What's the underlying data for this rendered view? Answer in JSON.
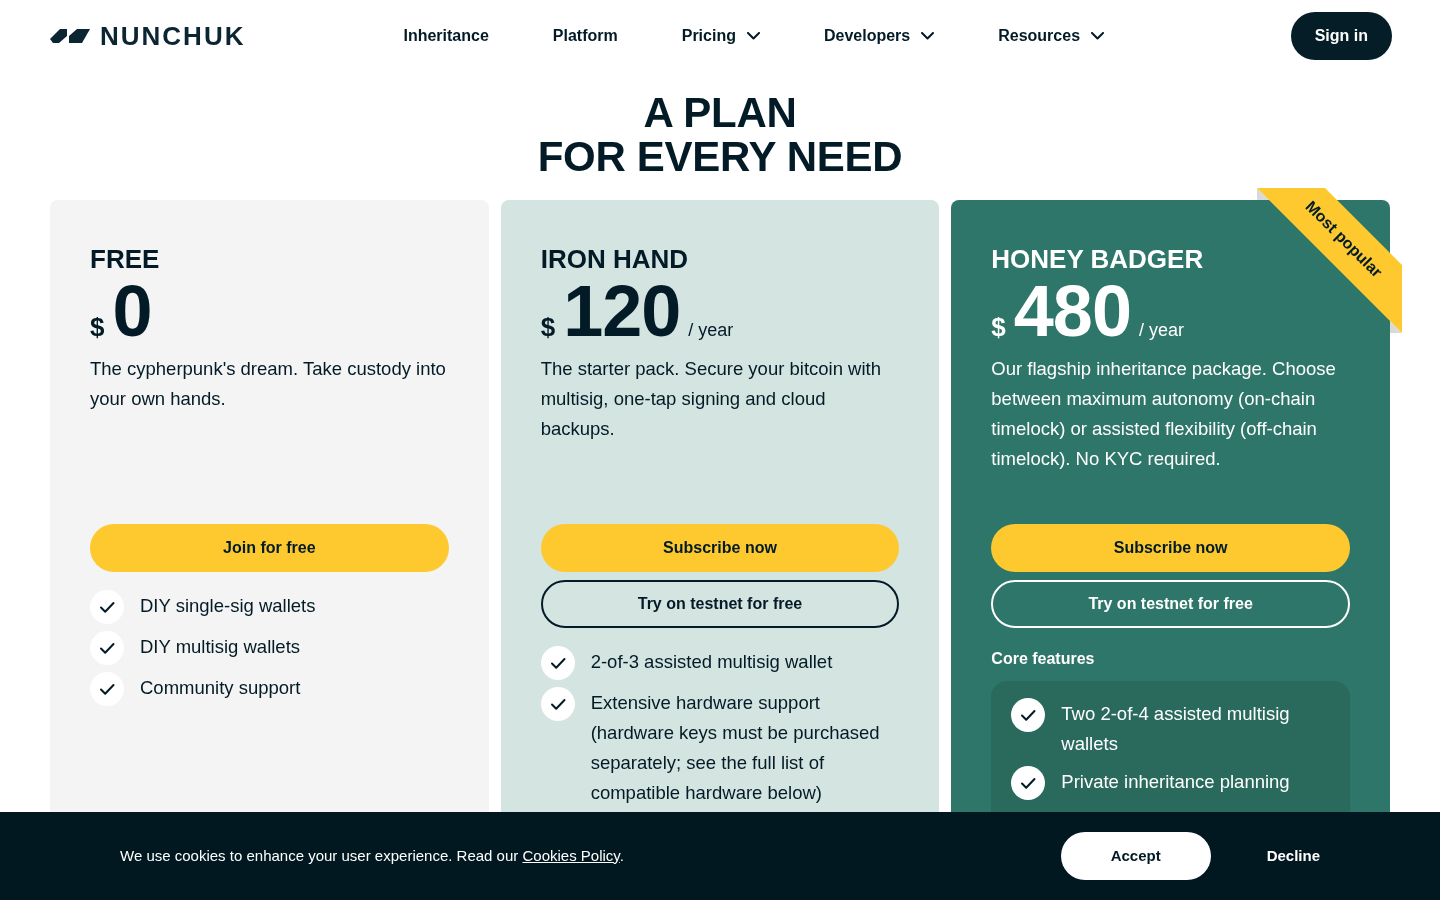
{
  "header": {
    "logo": "NUNCHUK",
    "nav": [
      {
        "label": "Inheritance",
        "dropdown": false
      },
      {
        "label": "Platform",
        "dropdown": false
      },
      {
        "label": "Pricing",
        "dropdown": true
      },
      {
        "label": "Developers",
        "dropdown": true
      },
      {
        "label": "Resources",
        "dropdown": true
      }
    ],
    "sign_in": "Sign in"
  },
  "hero": {
    "title_lines": [
      "A PLAN",
      "FOR EVERY NEED"
    ]
  },
  "plans": [
    {
      "kind": "basic",
      "name": "FREE",
      "currency": "$",
      "price": "0",
      "description": "The cypherpunk's dream. Take custody into your own hands.",
      "buttons": [
        {
          "kind": "primary",
          "label": "Join for free"
        }
      ],
      "features": [
        "DIY single-sig wallets",
        "DIY multisig wallets",
        "Community support"
      ]
    },
    {
      "kind": "standard",
      "name": "IRON HAND",
      "currency": "$",
      "price": "120",
      "period": "/ year",
      "description": "The starter pack. Secure your bitcoin with multisig, one-tap signing and cloud backups.",
      "buttons": [
        {
          "kind": "primary",
          "label": "Subscribe now"
        },
        {
          "kind": "outline",
          "label": "Try on testnet for free"
        }
      ],
      "features": [
        "2-of-3 assisted multisig wallet",
        "Extensive hardware support (hardware keys must be purchased separately; see the full list of compatible hardware below)"
      ]
    },
    {
      "kind": "featured",
      "ribbon": "Most popular",
      "name": "HONEY BADGER",
      "currency": "$",
      "price": "480",
      "period": "/ year",
      "description": "Our flagship inheritance package. Choose between maximum autonomy (on-chain timelock) or assisted flexibility (off-chain timelock). No KYC required.",
      "buttons": [
        {
          "kind": "primary",
          "label": "Subscribe now"
        },
        {
          "kind": "outline",
          "label": "Try on testnet for free"
        }
      ],
      "features_heading": "Core features",
      "features": [
        "Two 2-of-4 assisted multisig wallets",
        "Private inheritance planning"
      ]
    }
  ],
  "cookie_banner": {
    "text": "We use cookies to enhance your user experience. Read our",
    "link": "Cookies Policy",
    "end": ".",
    "accept": "Accept",
    "decline": "Decline"
  }
}
